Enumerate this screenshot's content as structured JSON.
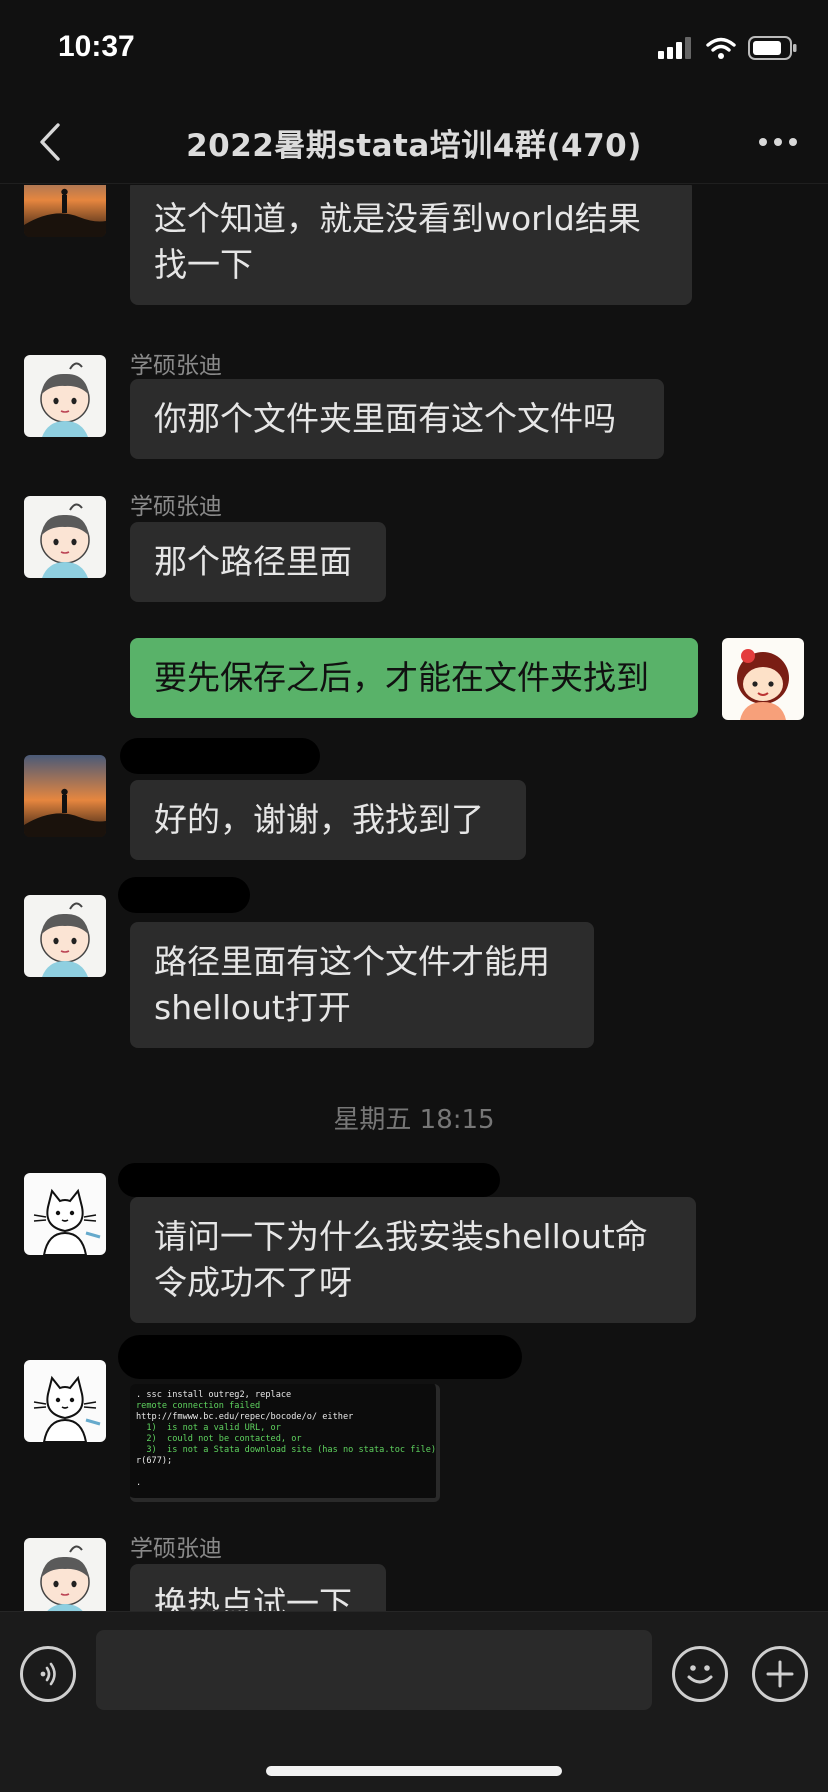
{
  "status_bar": {
    "time": "10:37",
    "icons": [
      "signal-icon",
      "wifi-icon",
      "battery-icon"
    ]
  },
  "nav": {
    "title": "2022暑期stata培训4群(470)",
    "back_icon": "chevron-left-icon",
    "more_icon": "more-dots-icon"
  },
  "messages": [
    {
      "sender": "",
      "text": "这个知道，就是没看到world结果\n找一下",
      "avatar": "sunset-avatar",
      "self": false
    },
    {
      "sender": "学硕张迪",
      "text": "你那个文件夹里面有这个文件吗",
      "avatar": "child-avatar",
      "self": false
    },
    {
      "sender": "学硕张迪",
      "text": "那个路径里面",
      "avatar": "child-avatar",
      "self": false
    },
    {
      "sender": "",
      "text": "要先保存之后，才能在文件夹找到",
      "avatar": "cartoon-girl-avatar",
      "self": true
    },
    {
      "sender": "",
      "text": "好的，谢谢，我找到了",
      "avatar": "sunset-avatar",
      "self": false
    },
    {
      "sender": "",
      "text": "路径里面有这个文件才能用\nshellout打开",
      "avatar": "child-avatar",
      "self": false
    },
    {
      "sender": "",
      "text": "请问一下为什么我安装shellout命\n令成功不了呀",
      "avatar": "cat-avatar",
      "self": false
    },
    {
      "sender": "",
      "text": "",
      "avatar": "cat-avatar",
      "self": false,
      "is_image": true
    },
    {
      "sender": "学硕张迪",
      "text": "换热点试一下",
      "avatar": "child-avatar",
      "self": false
    }
  ],
  "time_divider": "星期五 18:15",
  "screenshot_lines": [
    {
      "text": ". ssc install outreg2, replace",
      "color": "#e8e8e8"
    },
    {
      "text": "remote connection failed",
      "color": "#5fd35f"
    },
    {
      "text": "http://fmwww.bc.edu/repec/bocode/o/ either",
      "color": "#e8e8e8"
    },
    {
      "text": "  1)  is not a valid URL, or",
      "color": "#5fd35f"
    },
    {
      "text": "  2)  could not be contacted, or",
      "color": "#5fd35f"
    },
    {
      "text": "  3)  is not a Stata download site (has no stata.toc file).",
      "color": "#5fd35f"
    },
    {
      "text": "r(677);",
      "color": "#e8e8e8"
    },
    {
      "text": "",
      "color": "#e8e8e8"
    },
    {
      "text": ".",
      "color": "#e8e8e8"
    }
  ],
  "input_bar": {
    "placeholder": "",
    "voice_icon": "voice-icon",
    "emoji_icon": "emoji-icon",
    "plus_icon": "plus-icon"
  }
}
